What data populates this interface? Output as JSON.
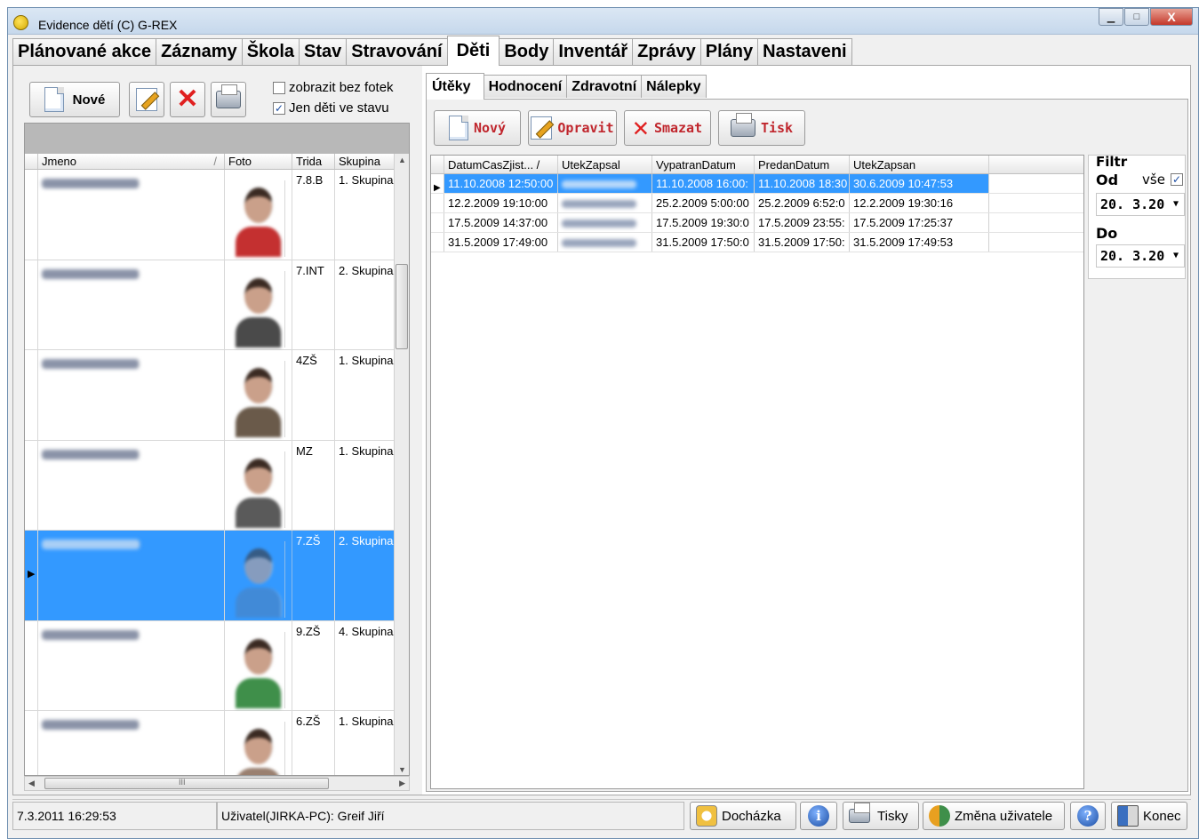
{
  "window": {
    "title": "Evidence dětí (C) G-REX",
    "min_label": "▁",
    "max_label": "□",
    "close_label": "X"
  },
  "main_tabs": [
    "Plánované akce",
    "Záznamy",
    "Škola",
    "Stav",
    "Stravování",
    "Děti",
    "Body",
    "Inventář",
    "Zprávy",
    "Plány",
    "Nastaveni"
  ],
  "main_tabs_active": "Děti",
  "left": {
    "new_label": "Nové",
    "chk_no_photo": "zobrazit bez fotek",
    "chk_no_photo_checked": false,
    "chk_in_state": "Jen děti ve stavu",
    "chk_in_state_checked": true,
    "columns": [
      "Jmeno",
      "Foto",
      "Trida",
      "Skupina"
    ],
    "rows": [
      {
        "trida": "7.8.B",
        "skupina": "1. Skupina",
        "shirt": "#c43030"
      },
      {
        "trida": "7.INT",
        "skupina": "2. Skupina",
        "shirt": "#4a4a4a"
      },
      {
        "trida": "4ZŠ",
        "skupina": "1. Skupina",
        "shirt": "#6a5a4a"
      },
      {
        "trida": "MZ",
        "skupina": "1. Skupina",
        "shirt": "#5a5a5a"
      },
      {
        "trida": "7.ZŠ",
        "skupina": "2. Skupina",
        "shirt": "#4e7fb8",
        "selected": true
      },
      {
        "trida": "9.ZŠ",
        "skupina": "4. Skupina",
        "shirt": "#3f8f4a"
      },
      {
        "trida": "6.ZŠ",
        "skupina": "1. Skupina",
        "shirt": "#9a8070"
      }
    ],
    "hscroll_label": "III"
  },
  "sub_tabs": [
    "Útěky",
    "Hodnocení",
    "Zdravotní",
    "Nálepky"
  ],
  "sub_tabs_active": "Útěky",
  "toolbar": {
    "new": "Nový",
    "edit": "Opravit",
    "delete": "Smazat",
    "print": "Tisk"
  },
  "uteky": {
    "columns": [
      "DatumCasZjist... /",
      "UtekZapsal",
      "VypatranDatum",
      "PredanDatum",
      "UtekZapsan"
    ],
    "rows": [
      {
        "datum": "11.10.2008 12:50:00",
        "vypatran": "11.10.2008 16:00:",
        "predan": "11.10.2008 18:30",
        "zapsan": "30.6.2009 10:47:53",
        "selected": true
      },
      {
        "datum": "12.2.2009 19:10:00",
        "vypatran": "25.2.2009 5:00:00",
        "predan": "25.2.2009 6:52:0",
        "zapsan": "12.2.2009 19:30:16"
      },
      {
        "datum": "17.5.2009 14:37:00",
        "vypatran": "17.5.2009 19:30:0",
        "predan": "17.5.2009 23:55:",
        "zapsan": "17.5.2009 17:25:37"
      },
      {
        "datum": "31.5.2009 17:49:00",
        "vypatran": "31.5.2009 17:50:0",
        "predan": "31.5.2009 17:50:",
        "zapsan": "31.5.2009 17:49:53"
      }
    ]
  },
  "filter": {
    "title": "Filtr",
    "od": "Od",
    "vse": "vše",
    "vse_checked": true,
    "do": "Do",
    "od_value": "20. 3.20",
    "do_value": "20. 3.20"
  },
  "status": {
    "datetime": "7.3.2011 16:29:53",
    "user": "Uživatel(JIRKA-PC): Greif Jiří",
    "dochazka": "Docházka",
    "tisky": "Tisky",
    "zmena": "Změna uživatele",
    "konec": "Konec"
  },
  "colors": {
    "selection": "#3399ff",
    "toolbar_text": "#c0262d"
  }
}
